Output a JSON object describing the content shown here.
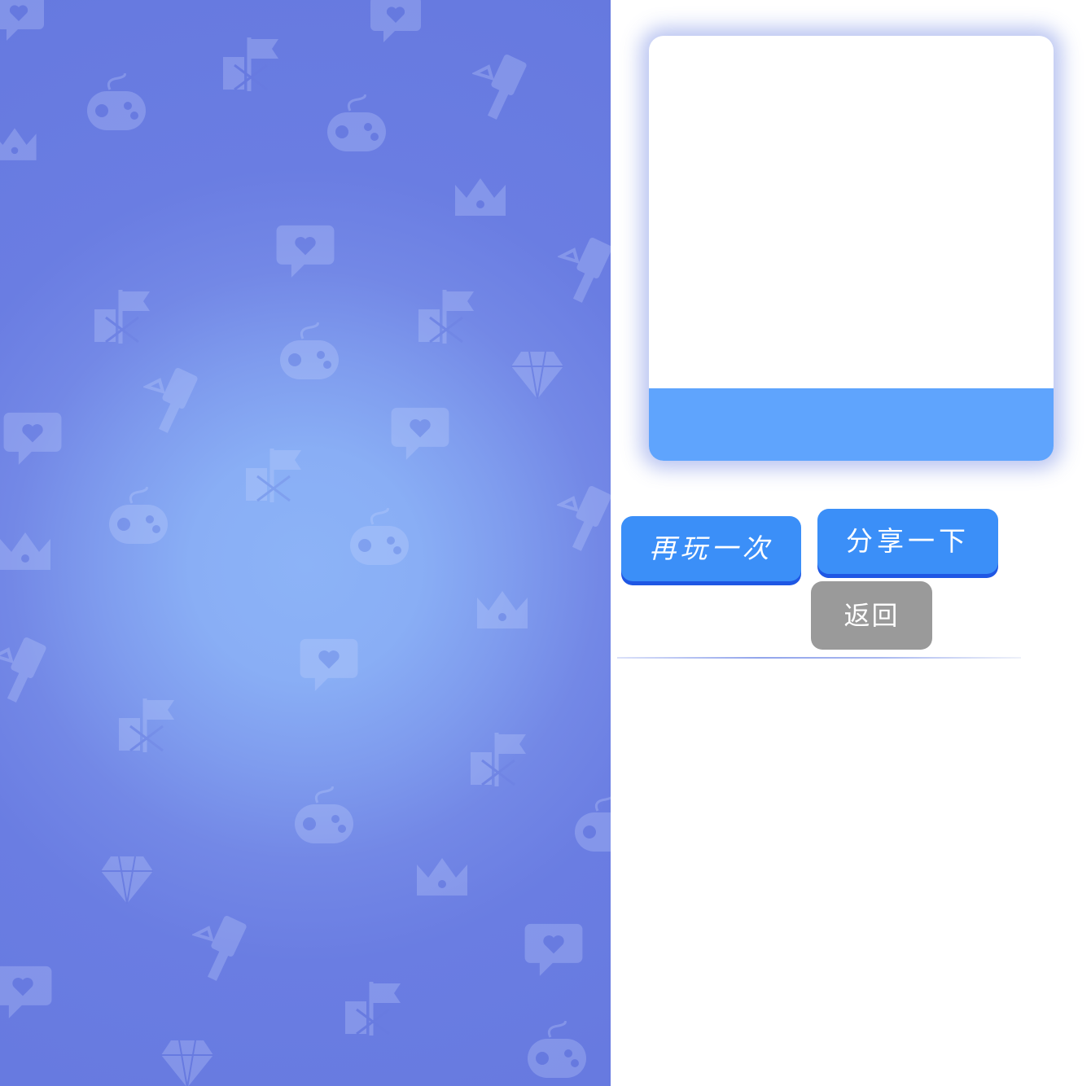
{
  "stage": {
    "background_center_color": "#8cb3f7",
    "background_edge_color": "#6679df",
    "pattern_icons": [
      "gamepad-icon",
      "heart-chat-icon",
      "crown-icon",
      "diamond-icon",
      "flag-fist-icon",
      "hammer-icon"
    ]
  },
  "result_card": {
    "band_color": "#5fa4fd"
  },
  "buttons": {
    "play_again_label": "再玩一次",
    "share_label": "分享一下",
    "back_label": "返回",
    "primary_color": "#3b8ff8",
    "secondary_color": "#9a9a9a"
  }
}
